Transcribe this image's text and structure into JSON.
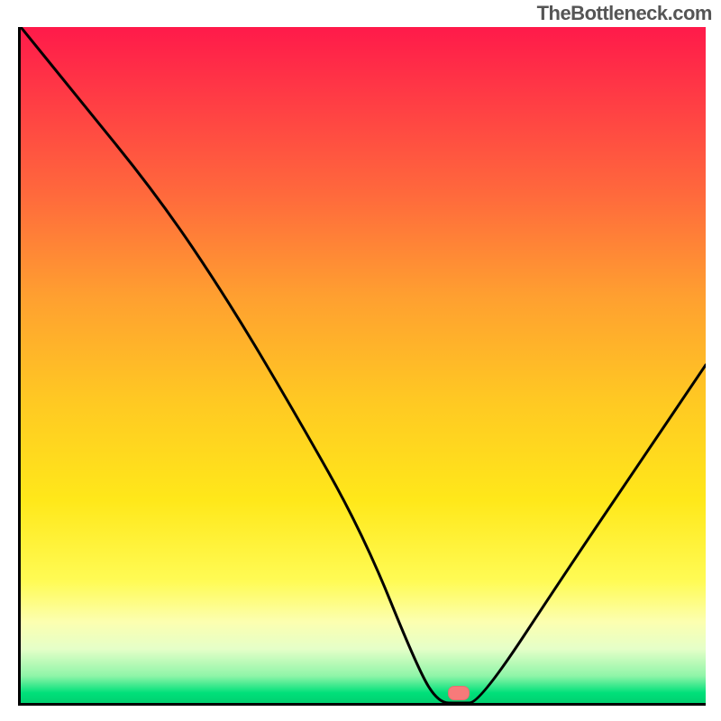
{
  "watermark": "TheBottleneck.com",
  "marker": {
    "x_pct": 64,
    "y_pct": 98.5
  },
  "chart_data": {
    "type": "line",
    "title": "",
    "xlabel": "",
    "ylabel": "",
    "xlim": [
      0,
      100
    ],
    "ylim": [
      0,
      100
    ],
    "grid": false,
    "legend": false,
    "series": [
      {
        "name": "bottleneck-curve",
        "x": [
          0,
          8,
          20,
          30,
          40,
          50,
          58,
          61,
          64,
          67,
          80,
          90,
          100
        ],
        "y": [
          100,
          90,
          75,
          60,
          43,
          25,
          5,
          0,
          0,
          0,
          20,
          35,
          50
        ]
      }
    ],
    "marker_point": {
      "x": 64,
      "y": 0
    },
    "background_gradient_stops": [
      {
        "pct": 0,
        "color": "#ff1a4a"
      },
      {
        "pct": 10,
        "color": "#ff3a45"
      },
      {
        "pct": 25,
        "color": "#ff6a3c"
      },
      {
        "pct": 40,
        "color": "#ffa030"
      },
      {
        "pct": 55,
        "color": "#ffc823"
      },
      {
        "pct": 70,
        "color": "#ffe81a"
      },
      {
        "pct": 82,
        "color": "#fffb55"
      },
      {
        "pct": 88,
        "color": "#fcffb0"
      },
      {
        "pct": 92,
        "color": "#e5ffc8"
      },
      {
        "pct": 96,
        "color": "#8ff5a8"
      },
      {
        "pct": 98.5,
        "color": "#00e07a"
      },
      {
        "pct": 100,
        "color": "#00d070"
      }
    ]
  }
}
